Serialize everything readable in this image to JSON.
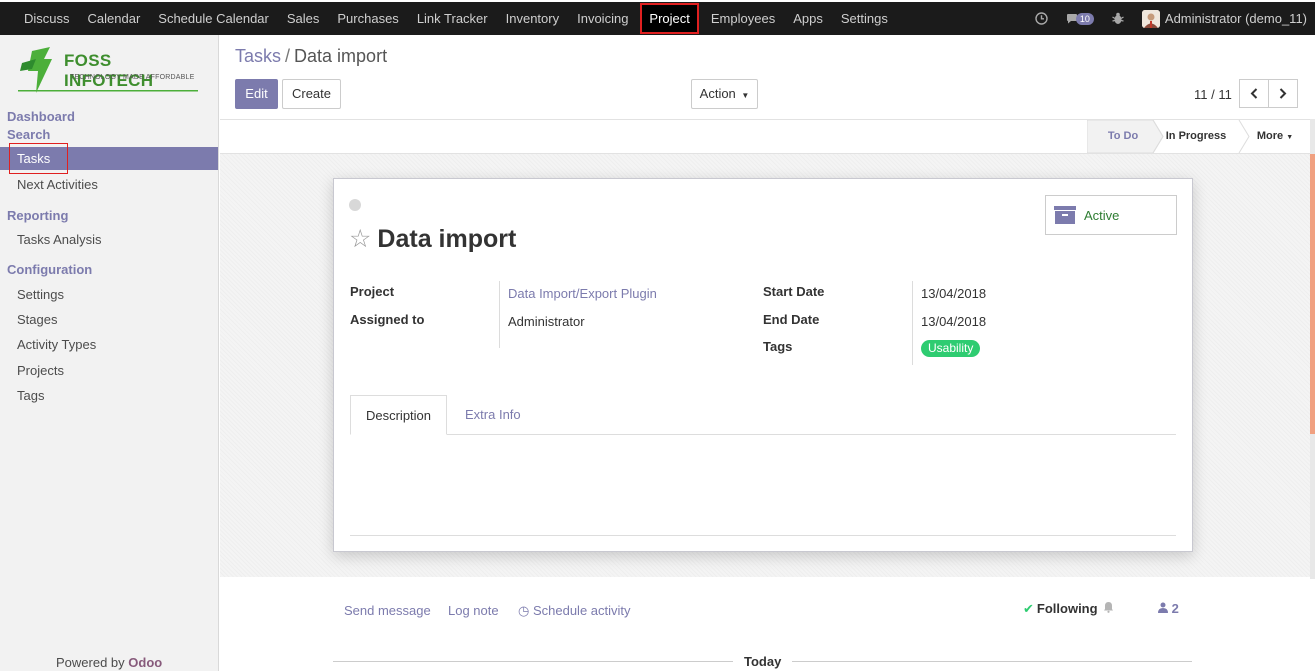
{
  "topnav": {
    "items": [
      "Discuss",
      "Calendar",
      "Schedule Calendar",
      "Sales",
      "Purchases",
      "Link Tracker",
      "Inventory",
      "Invoicing",
      "Project",
      "Employees",
      "Apps",
      "Settings"
    ],
    "active": "Project",
    "messages_count": "10",
    "user": "Administrator (demo_11)"
  },
  "sidebar": {
    "logo_name": "FOSS INFOTECH",
    "logo_tagline": "TECHNOLOGY MADE AFFORDABLE",
    "sections": {
      "dashboard": "Dashboard",
      "search": "Search",
      "reporting": "Reporting",
      "configuration": "Configuration"
    },
    "items": {
      "tasks": "Tasks",
      "next_activities": "Next Activities",
      "tasks_analysis": "Tasks Analysis",
      "settings": "Settings",
      "stages": "Stages",
      "activity_types": "Activity Types",
      "projects": "Projects",
      "tags": "Tags"
    },
    "powered_by": "Powered by",
    "powered_brand": "Odoo"
  },
  "breadcrumb": {
    "parent": "Tasks",
    "separator": "/",
    "current": "Data import"
  },
  "buttons": {
    "edit": "Edit",
    "create": "Create",
    "action": "Action"
  },
  "pager": {
    "value": "11 / 11"
  },
  "stages": {
    "todo": "To Do",
    "in_progress": "In Progress",
    "more": "More"
  },
  "task": {
    "title": "Data import",
    "active_label": "Active",
    "fields": {
      "project_label": "Project",
      "project_value": "Data Import/Export Plugin",
      "assigned_label": "Assigned to",
      "assigned_value": "Administrator",
      "start_label": "Start Date",
      "start_value": "13/04/2018",
      "end_label": "End Date",
      "end_value": "13/04/2018",
      "tags_label": "Tags",
      "tag_value": "Usability"
    },
    "tabs": [
      "Description",
      "Extra Info"
    ]
  },
  "chatter": {
    "send_message": "Send message",
    "log_note": "Log note",
    "schedule_activity": "Schedule activity",
    "following": "Following",
    "followers_count": "2",
    "today": "Today"
  },
  "colors": {
    "primary": "#7c7bad",
    "navbar": "#1b1b1b",
    "tag_green": "#2ecc71",
    "highlight_red": "#e02020"
  }
}
